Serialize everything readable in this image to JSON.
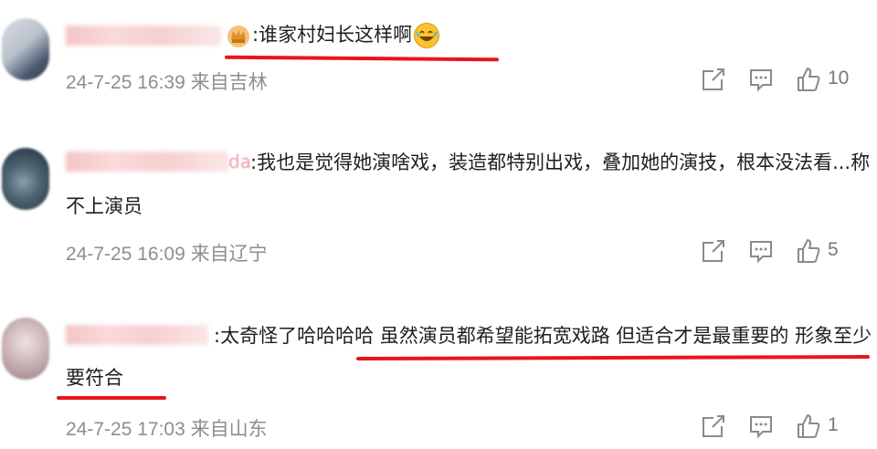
{
  "comments": [
    {
      "name_tail": "",
      "text_lines": [
        ":谁家村妇长这样啊"
      ],
      "meta": "24-7-25 16:39 来自吉林",
      "likes": "10"
    },
    {
      "name_tail": "da",
      "text_lines": [
        ":我也是觉得她演啥戏，装造都特别出戏，叠加她的演技，根本没法看...称",
        "不上演员"
      ],
      "meta": "24-7-25 16:09 来自辽宁",
      "likes": "5"
    },
    {
      "name_tail": "明",
      "text_lines": [
        ":太奇怪了哈哈哈哈 虽然演员都希望能拓宽戏路 但适合才是最重要的 形象至少",
        "要符合"
      ],
      "meta": "24-7-25 17:03 来自山东",
      "likes": "1"
    }
  ],
  "colors": {
    "underline": "#e8151b",
    "meta": "#8e8e8e"
  },
  "icons": [
    "share-icon",
    "comment-icon",
    "like-icon",
    "crown-badge-icon",
    "laughing-emoji-icon"
  ]
}
